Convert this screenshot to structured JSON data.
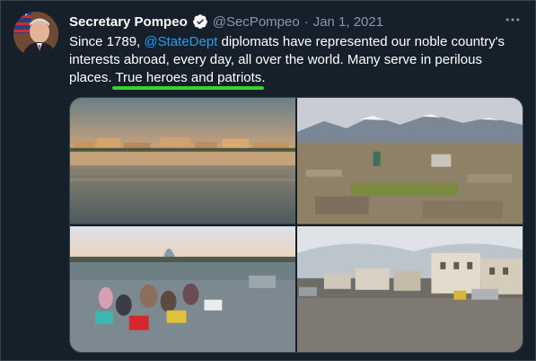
{
  "tweet": {
    "author_name": "Secretary Pompeo",
    "handle": "@SecPompeo",
    "separator": "·",
    "date": "Jan 1, 2021",
    "more_label": "···",
    "text_part1": "Since 1789, ",
    "mention": "@StateDept",
    "text_part2": " diplomats have represented our noble country's interests abroad, every day, all over the world. Many serve in perilous places. ",
    "text_highlight": "True heroes and patriots",
    "text_end": ".",
    "highlight_color": "#39d32d",
    "link_color": "#1da1f2",
    "background": "#15202b"
  },
  "icons": {
    "verified": "verified-badge-icon",
    "more": "more-options-icon"
  }
}
